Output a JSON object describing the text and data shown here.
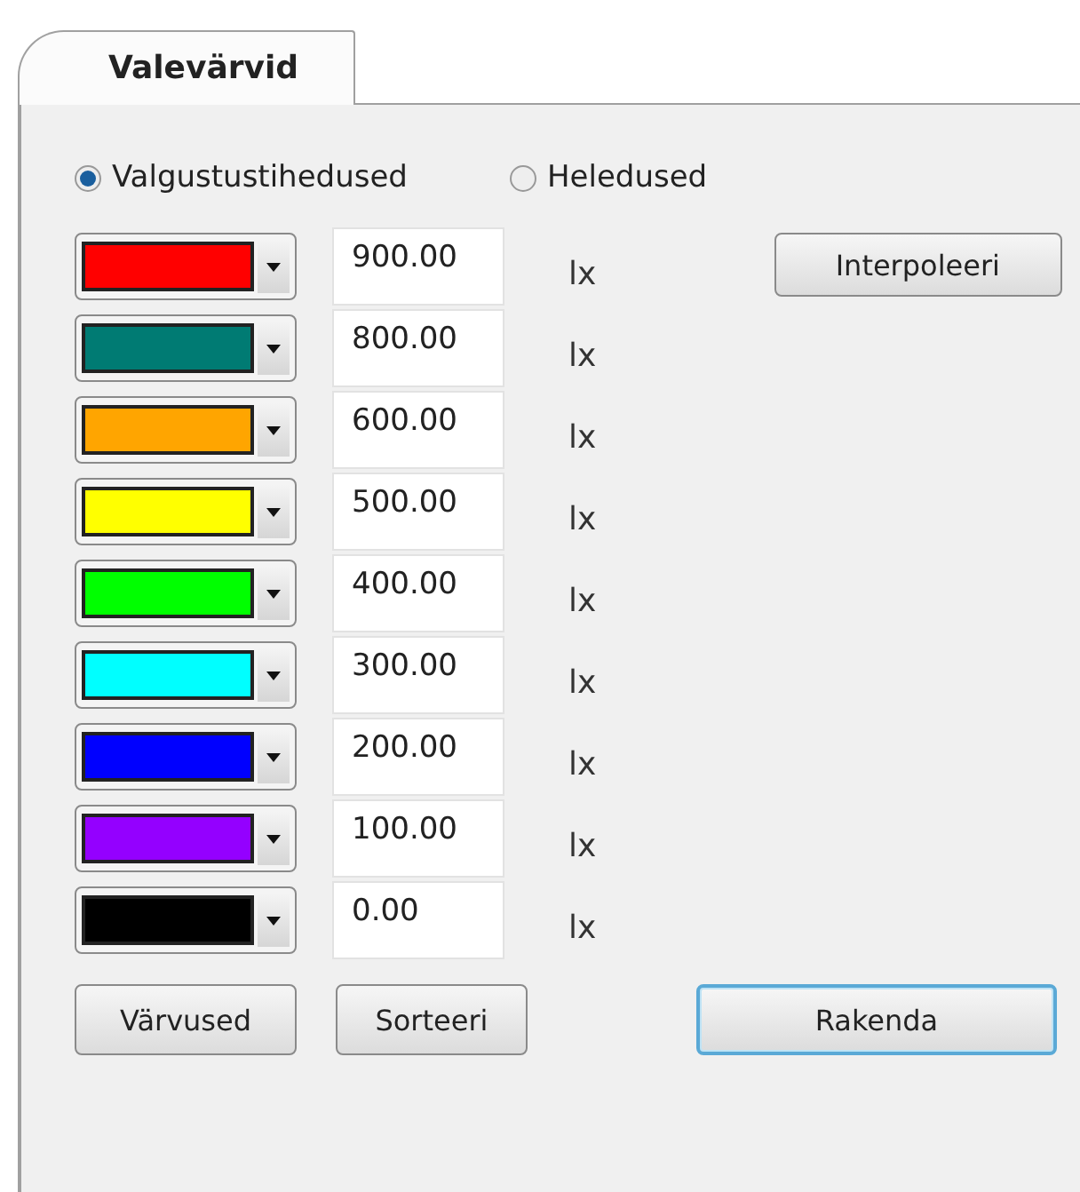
{
  "tabs": [
    {
      "label": "Valevärvid",
      "selected": true
    }
  ],
  "mode_options": [
    {
      "label": "Valgustustihedused",
      "selected": true
    },
    {
      "label": "Heledused",
      "selected": false
    }
  ],
  "levels": [
    {
      "color": "#ff0000",
      "value": "900.00",
      "unit": "lx"
    },
    {
      "color": "#007b73",
      "value": "800.00",
      "unit": "lx"
    },
    {
      "color": "#ffa500",
      "value": "600.00",
      "unit": "lx"
    },
    {
      "color": "#ffff00",
      "value": "500.00",
      "unit": "lx"
    },
    {
      "color": "#00ff00",
      "value": "400.00",
      "unit": "lx"
    },
    {
      "color": "#00ffff",
      "value": "300.00",
      "unit": "lx"
    },
    {
      "color": "#0000ff",
      "value": "200.00",
      "unit": "lx"
    },
    {
      "color": "#9400ff",
      "value": "100.00",
      "unit": "lx"
    },
    {
      "color": "#000000",
      "value": "0.00",
      "unit": "lx"
    }
  ],
  "interpolate_button": "Interpoleeri",
  "buttons": [
    {
      "label": "Värvused",
      "default": false
    },
    {
      "label": "Sorteeri",
      "default": false
    },
    {
      "label": "Rakenda",
      "default": true
    }
  ]
}
